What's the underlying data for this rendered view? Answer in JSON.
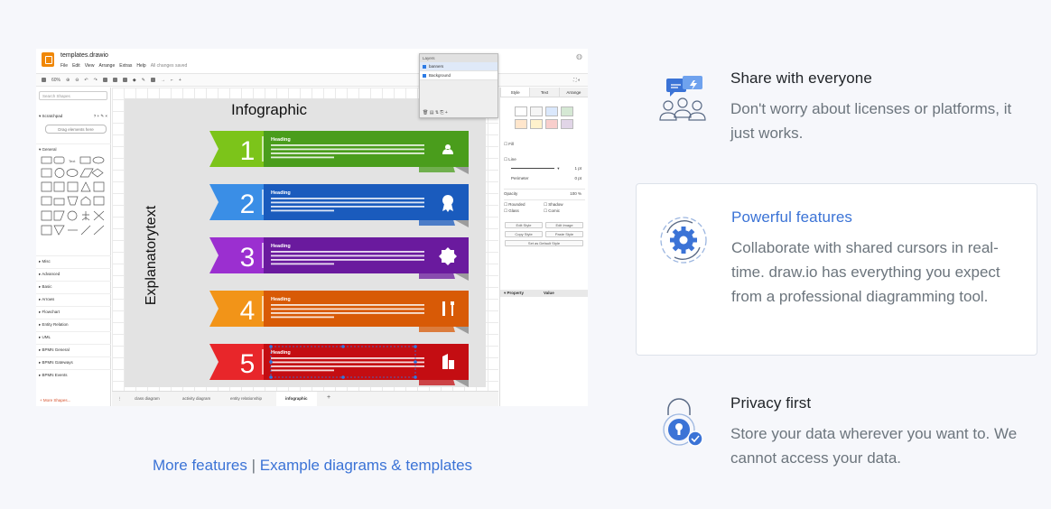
{
  "screenshot": {
    "file_name": "templates.drawio",
    "menu": [
      "File",
      "Edit",
      "View",
      "Arrange",
      "Extras",
      "Help"
    ],
    "save_status": "All changes saved",
    "zoom": "60%",
    "search_placeholder": "Search Shapes",
    "scratchpad_label": "Scratchpad",
    "scratchpad_tools": "? + ✎ ×",
    "drag_hint": "Drag elements here",
    "general_label": "General",
    "library_sections": [
      "Misc",
      "Advanced",
      "Basic",
      "Arrows",
      "Flowchart",
      "Entity Relation",
      "UML",
      "BPMN General",
      "BPMN Gateways",
      "BPMN Events"
    ],
    "more_shapes": "+ More Shapes...",
    "layers": {
      "title": "Layers",
      "items": [
        "banners",
        "Background"
      ]
    },
    "format_tabs": [
      "Style",
      "Text",
      "Arrange"
    ],
    "format": {
      "fill": "Fill",
      "line": "Line",
      "line_width": "1 pt",
      "perimeter": "Perimeter",
      "perimeter_value": "0 pt",
      "opacity": "Opacity",
      "opacity_value": "100 %",
      "options": [
        "Rounded",
        "Shadow",
        "Glass",
        "Comic"
      ],
      "buttons": [
        "Edit Style",
        "Edit Image",
        "Copy Style",
        "Paste Style",
        "Set as Default Style"
      ],
      "prop_header": [
        "Property",
        "Value"
      ]
    },
    "page_tabs": [
      "class diagram",
      "activity diagram",
      "entity relationship",
      "infographic"
    ],
    "active_page": "infographic",
    "infographic": {
      "title": "Infographic",
      "side_label": "Explanatorytext",
      "banners": [
        {
          "num": "1",
          "heading": "Heading",
          "color": "#4a9d1c",
          "color2": "#7cc41a",
          "icon": "people-icon"
        },
        {
          "num": "2",
          "heading": "Heading",
          "color": "#1a5bbd",
          "color2": "#3a8ee6",
          "icon": "award-icon"
        },
        {
          "num": "3",
          "heading": "Heading",
          "color": "#6a1a9e",
          "color2": "#9b2fd0",
          "icon": "check-badge-icon"
        },
        {
          "num": "4",
          "heading": "Heading",
          "color": "#d85a06",
          "color2": "#f29418",
          "icon": "tools-icon"
        },
        {
          "num": "5",
          "heading": "Heading",
          "color": "#c40d12",
          "color2": "#e8262a",
          "icon": "building-icon"
        }
      ]
    }
  },
  "links": {
    "more_features": "More features",
    "separator": "|",
    "examples": "Example diagrams & templates",
    "color": "#3b73d6"
  },
  "features": [
    {
      "title": "Share with everyone",
      "description": "Don't worry about licenses or platforms, it just works.",
      "icon": "share-people-icon"
    },
    {
      "title": "Powerful features",
      "description": "Collaborate with shared cursors in real-time. draw.io has everything you expect from a professional diagramming tool.",
      "icon": "gear-cycle-icon"
    },
    {
      "title": "Privacy first",
      "description": "Store your data wherever you want to. We cannot access your data.",
      "icon": "lock-check-icon"
    }
  ]
}
